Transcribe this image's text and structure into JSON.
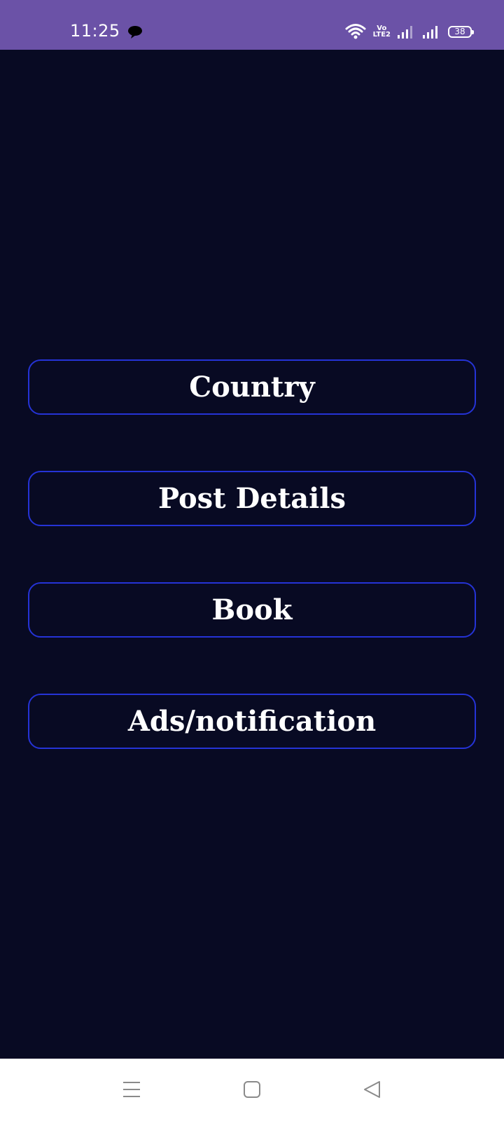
{
  "status_bar": {
    "time": "11:25",
    "volte": "Vo",
    "lte": "LTE2",
    "battery": "38",
    "background_color": "#6b52a7"
  },
  "menu": {
    "buttons": [
      {
        "label": "Country"
      },
      {
        "label": "Post Details"
      },
      {
        "label": "Book"
      },
      {
        "label": "Ads/notification"
      }
    ],
    "border_color": "#2533d6",
    "background_color": "#080a23"
  },
  "nav_bar": {
    "icons": [
      "menu-icon",
      "home-icon",
      "back-icon"
    ]
  }
}
